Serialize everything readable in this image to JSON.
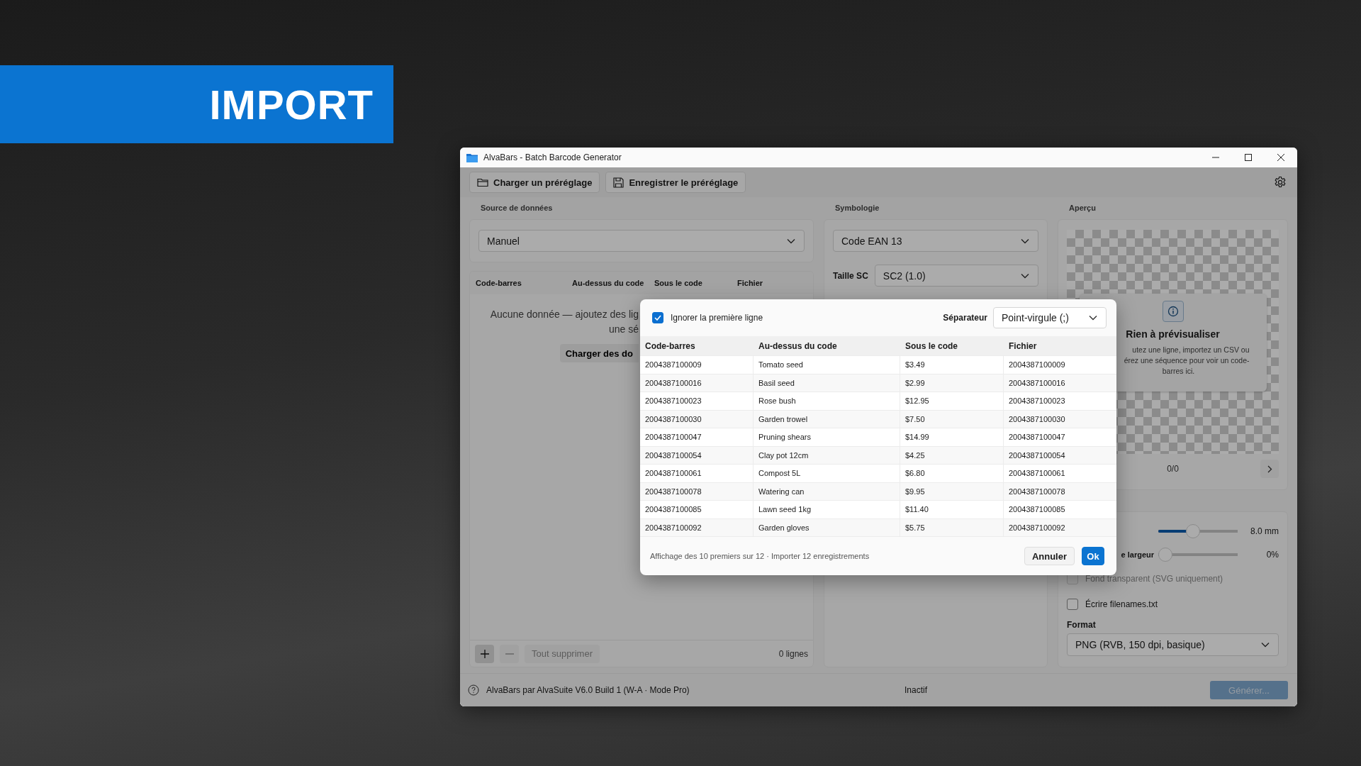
{
  "banner": {
    "title": "IMPORT"
  },
  "window": {
    "title": "AlvaBars - Batch Barcode Generator"
  },
  "toolbar": {
    "buttons": [
      {
        "label": "Charger un préréglage",
        "kind": "open"
      },
      {
        "label": "Enregistrer le préréglage",
        "kind": "save"
      }
    ]
  },
  "data_source": {
    "label": "Source de données",
    "value": "Manuel",
    "columns": [
      "Code-barres",
      "Au-dessus du code",
      "Sous le code",
      "Fichier"
    ],
    "empty_message": [
      "Aucune donnée — ajoutez des lig",
      "une sé"
    ],
    "load_button": "Charger des do",
    "actions": [
      {
        "kind": "add",
        "disabled": false
      },
      {
        "kind": "remove",
        "disabled": true
      },
      {
        "kind": "text",
        "label": "Tout supprimer",
        "disabled": true
      }
    ],
    "row_count": "0 lignes"
  },
  "symbology": {
    "label": "Symbologie",
    "value": "Code EAN 13",
    "size_label": "Taille SC",
    "size_value": "SC2 (1.0)"
  },
  "preview": {
    "label": "Aperçu",
    "title": "Rien à prévisualiser",
    "message": [
      "utez une ligne, importez un CSV ou",
      "érez une séquence pour voir un code-",
      "barres ici."
    ],
    "counter": "0/0"
  },
  "settings": {
    "sliders": [
      {
        "level": 0.42,
        "reading": "8.0 mm"
      },
      {
        "label": "e largeur",
        "level": 0,
        "reading": "0%"
      }
    ],
    "checkboxes": [
      {
        "label": "Fond transparent (SVG uniquement)",
        "checked": false,
        "disabled": true
      },
      {
        "label": "Écrire filenames.txt",
        "checked": false,
        "disabled": false
      }
    ],
    "format": {
      "label": "Format",
      "value": "PNG (RVB, 150 dpi, basique)"
    }
  },
  "status_bar": {
    "text": "AlvaBars par AlvaSuite V6.0 Build 1 (W-A · Mode Pro)",
    "state": "Inactif",
    "generate_button": {
      "label": "Générer...",
      "disabled": true
    }
  },
  "dialog": {
    "ignore_first_line": {
      "label": "Ignorer la première ligne",
      "checked": true
    },
    "separator": {
      "label": "Séparateur",
      "value": "Point-virgule (;)"
    },
    "table": {
      "columns": [
        "Code-barres",
        "Au-dessus du code",
        "Sous le code",
        "Fichier"
      ],
      "rows": [
        [
          "2004387100009",
          "Tomato seed",
          "$3.49",
          "2004387100009"
        ],
        [
          "2004387100016",
          "Basil seed",
          "$2.99",
          "2004387100016"
        ],
        [
          "2004387100023",
          "Rose bush",
          "$12.95",
          "2004387100023"
        ],
        [
          "2004387100030",
          "Garden trowel",
          "$7.50",
          "2004387100030"
        ],
        [
          "2004387100047",
          "Pruning shears",
          "$14.99",
          "2004387100047"
        ],
        [
          "2004387100054",
          "Clay pot 12cm",
          "$4.25",
          "2004387100054"
        ],
        [
          "2004387100061",
          "Compost 5L",
          "$6.80",
          "2004387100061"
        ],
        [
          "2004387100078",
          "Watering can",
          "$9.95",
          "2004387100078"
        ],
        [
          "2004387100085",
          "Lawn seed 1kg",
          "$11.40",
          "2004387100085"
        ],
        [
          "2004387100092",
          "Garden gloves",
          "$5.75",
          "2004387100092"
        ]
      ]
    },
    "summary": "Affichage des 10 premiers sur 12 · Importer 12 enregistrements",
    "buttons": [
      {
        "label": "Annuler",
        "kind": "secondary"
      },
      {
        "label": "Ok",
        "kind": "primary"
      }
    ]
  }
}
